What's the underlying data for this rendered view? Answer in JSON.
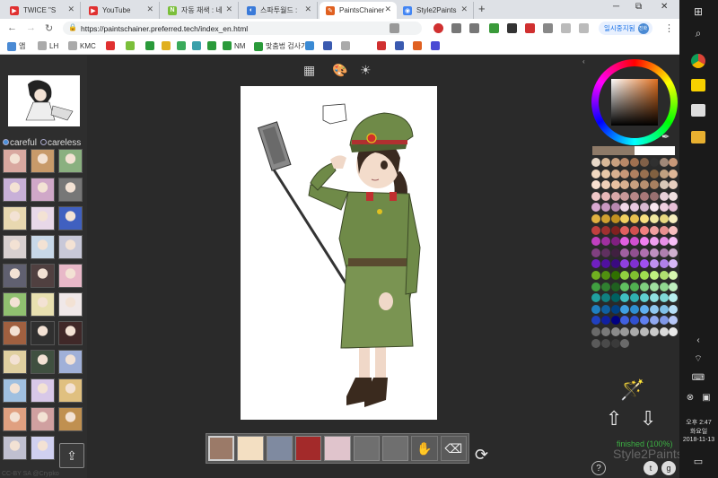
{
  "tabs": [
    {
      "title": "TWICE \"S",
      "fav_color": "#e03030",
      "fav_glyph": "▶"
    },
    {
      "title": "YouTube",
      "fav_color": "#e03030",
      "fav_glyph": "▶"
    },
    {
      "title": "자동 채색 : 네",
      "fav_color": "#7bbf3a",
      "fav_glyph": "N"
    },
    {
      "title": "스파투월드 : ",
      "fav_color": "#3a7ad9",
      "fav_glyph": "◐"
    },
    {
      "title": "PaintsChainer",
      "fav_color": "#e06020",
      "fav_glyph": "✎"
    },
    {
      "title": "Style2Paints",
      "fav_color": "#4285f4",
      "fav_glyph": "◉"
    }
  ],
  "window": {
    "newtab": "+",
    "minimize": "─",
    "maximize": "⧉",
    "close": "✕"
  },
  "toolbar": {
    "url": "https://paintschainer.preferred.tech/index_en.html",
    "profile_label": "일시중지됨",
    "profile_initial": "진화"
  },
  "bookmarks": [
    {
      "label": "앱",
      "color": "#4a8ad4"
    },
    {
      "label": "LH",
      "color": "#aaa"
    },
    {
      "label": "KMC",
      "color": "#aaa"
    },
    {
      "label": "",
      "color": "#e03030"
    },
    {
      "label": "",
      "color": "#7bbf3a"
    },
    {
      "label": "",
      "color": "#2a9a3a"
    },
    {
      "label": "",
      "color": "#e0b020"
    },
    {
      "label": "",
      "color": "#3aaa5a"
    },
    {
      "label": "",
      "color": "#3aa0aa"
    },
    {
      "label": "",
      "color": "#2a9a3a"
    },
    {
      "label": "NM",
      "color": "#2a9a3a"
    },
    {
      "label": "맞춤법 검사기",
      "color": "#2a9a3a"
    },
    {
      "label": "",
      "color": "#3a8ad4"
    },
    {
      "label": "",
      "color": "#3a5ab0"
    },
    {
      "label": "",
      "color": "#aaa"
    },
    {
      "label": "",
      "color": "#d03030"
    },
    {
      "label": "",
      "color": "#3a5ab0"
    },
    {
      "label": "",
      "color": "#e06020"
    },
    {
      "label": "",
      "color": "#4a4ad4"
    }
  ],
  "left": {
    "mode_careful": "careful",
    "mode_careless": "careless",
    "credit": "CC-BY SA @Crypko",
    "upload_glyph": "⇪"
  },
  "thumbs": [
    "#d9a8a0",
    "#c89a6a",
    "#8ab080",
    "#c8b0d8",
    "#d0a8c8",
    "#777777",
    "#e8d8b0",
    "#e8d8e8",
    "#4060c0",
    "#d8d0d0",
    "#c8d8e8",
    "#c8c8d8",
    "#606070",
    "#504040",
    "#e8b8c8",
    "#90c070",
    "#e8e0b0",
    "#f0e8e8",
    "#a06040",
    "#303030",
    "#402828",
    "#e0d0a0",
    "#405040",
    "#a0b0d8",
    "#a0c0e0",
    "#d8c8e8",
    "#e0c080",
    "#e0a080",
    "#d0a0a0",
    "#c09050",
    "#c0c0d0",
    "#d0d0f0"
  ],
  "center": {
    "grid_icon": "grid-icon",
    "palette_icon": "palette-icon",
    "brightness_icon": "sun-icon",
    "swatches": [
      "#9b7a68",
      "#f3dfc2",
      "#7f8aa0",
      "#a32a2a",
      "#e0c4cc",
      "#6f6f6f",
      "#6f6f6f"
    ],
    "hand_glyph": "✋",
    "eraser_glyph": "⌫",
    "refresh_glyph": "⟳"
  },
  "right": {
    "current_color": "#8e7a68",
    "status": "finished (100%)",
    "brand": "Style2Paints",
    "help": "?",
    "twitter": "t",
    "github": "g"
  },
  "dot_colors": [
    "#e8d8c8",
    "#d8b898",
    "#c8a080",
    "#b88868",
    "#a07050",
    "#806048",
    "#303030",
    "#a08878",
    "#c89878",
    "#f0d8c0",
    "#e8c8a8",
    "#d8b090",
    "#c89878",
    "#b08060",
    "#987050",
    "#806040",
    "#c0a080",
    "#e0b898",
    "#f8e0d0",
    "#f0d0b8",
    "#e8c0a0",
    "#d8b090",
    "#c8a080",
    "#b89070",
    "#a88060",
    "#d8c8b8",
    "#e8d0c0",
    "#f0c8c8",
    "#e8b8b8",
    "#d8a8a8",
    "#c89898",
    "#b88888",
    "#a87878",
    "#987070",
    "#e8d0d8",
    "#f0e0e0",
    "#d8a8d0",
    "#c898c0",
    "#b888b0",
    "#f0d8e8",
    "#e8c8e0",
    "#d8b8d0",
    "#f8e8f0",
    "#f0d0e0",
    "#e8c0d8",
    "#e0b040",
    "#d0a030",
    "#c09020",
    "#f0d060",
    "#e8c050",
    "#f8e080",
    "#f0e8a0",
    "#e8d880",
    "#f8f0c0",
    "#c04040",
    "#a03030",
    "#802020",
    "#e06060",
    "#d05050",
    "#f08080",
    "#f0a0a0",
    "#e89090",
    "#f8c0c0",
    "#c040c0",
    "#a030a0",
    "#802080",
    "#e060e0",
    "#d050d0",
    "#f080f0",
    "#f0a0f0",
    "#e890e8",
    "#f8c0f8",
    "#804080",
    "#603060",
    "#402040",
    "#a060a0",
    "#905090",
    "#b070b0",
    "#c090c0",
    "#b080b0",
    "#d0b0d0",
    "#7020c0",
    "#5010a0",
    "#3a0a80",
    "#9040e0",
    "#8030d0",
    "#a050f0",
    "#c090f0",
    "#b080e8",
    "#d8b8f8",
    "#70b020",
    "#509010",
    "#307000",
    "#90d040",
    "#80c030",
    "#a0e050",
    "#c0f080",
    "#b0e070",
    "#d8f8b0",
    "#40a040",
    "#308030",
    "#206020",
    "#60c060",
    "#50b050",
    "#80d080",
    "#a0e0a0",
    "#90d890",
    "#c0f0c0",
    "#20a0a0",
    "#108080",
    "#006060",
    "#40c0c0",
    "#30b0b0",
    "#60d0d0",
    "#90e0e0",
    "#80d8d8",
    "#b8f0f0",
    "#2080c0",
    "#1060a0",
    "#004080",
    "#40a0e0",
    "#3090d0",
    "#60b0f0",
    "#90c8f0",
    "#80c0e8",
    "#b8e0f8",
    "#2040c0",
    "#1020a0",
    "#000080",
    "#4060e0",
    "#3050d0",
    "#6080f0",
    "#90a8f0",
    "#8098e8",
    "#b8c8f8",
    "#6a6a6a",
    "#7a7a7a",
    "#8a8a8a",
    "#9a9a9a",
    "#aaaaaa",
    "#bababa",
    "#cacaca",
    "#dadada",
    "#eaeaea",
    "#5a5a5a",
    "#4a4a4a",
    "#3a3a3a",
    "#6a6a6a"
  ],
  "taskbar": {
    "time": "오후 2:47",
    "day": "화요일",
    "date": "2018-11-13"
  }
}
